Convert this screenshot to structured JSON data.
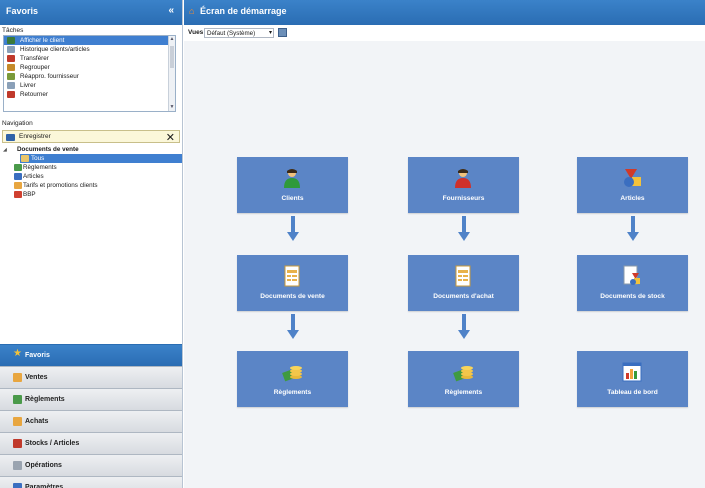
{
  "left": {
    "title": "Favoris",
    "collapse_glyph": "«",
    "taches_label": "Tâches",
    "taches": [
      {
        "label": "Afficher le client",
        "icon": "client-icon",
        "color": "#3a7a3a",
        "selected": true
      },
      {
        "label": "Historique clients/articles",
        "icon": "history-icon",
        "color": "#8aa0b8",
        "selected": false
      },
      {
        "label": "Transférer",
        "icon": "transfer-icon",
        "color": "#c0392b",
        "selected": false
      },
      {
        "label": "Regrouper",
        "icon": "group-icon",
        "color": "#c58a2a",
        "selected": false
      },
      {
        "label": "Réappro. fournisseur",
        "icon": "supplier-icon",
        "color": "#7a9a3a",
        "selected": false
      },
      {
        "label": "Livrer",
        "icon": "deliver-icon",
        "color": "#8aa0b8",
        "selected": false
      },
      {
        "label": "Retourner",
        "icon": "return-icon",
        "color": "#c0392b",
        "selected": false
      }
    ],
    "navigation_label": "Navigation",
    "enregistrer_label": "Enregistrer",
    "close_glyph": "✕",
    "tree": [
      {
        "label": "Documents de vente",
        "level": 0,
        "bold": true,
        "icon": "expand-icon",
        "color": "#555555",
        "selected": false
      },
      {
        "label": "Tous",
        "level": 2,
        "bold": false,
        "icon": "folder-icon",
        "color": "#e8c56a",
        "selected": true
      },
      {
        "label": "Règlements",
        "level": 1,
        "bold": false,
        "icon": "payment-icon",
        "color": "#4a9a4a",
        "selected": false
      },
      {
        "label": "Articles",
        "level": 1,
        "bold": false,
        "icon": "articles-icon",
        "color": "#3a6ec0",
        "selected": false
      },
      {
        "label": "Tarifs et promotions clients",
        "level": 1,
        "bold": false,
        "icon": "pricing-icon",
        "color": "#e8a640",
        "selected": false
      },
      {
        "label": "BBP",
        "level": 1,
        "bold": false,
        "icon": "bbp-icon",
        "color": "#d04030",
        "selected": false
      }
    ],
    "nav_buttons": [
      {
        "label": "Favoris",
        "icon": "star-icon",
        "color": "#f3c23a",
        "active": true
      },
      {
        "label": "Ventes",
        "icon": "sales-icon",
        "color": "#e8a640",
        "active": false
      },
      {
        "label": "Règlements",
        "icon": "payment-icon",
        "color": "#4a9a4a",
        "active": false
      },
      {
        "label": "Achats",
        "icon": "purchase-icon",
        "color": "#e8a640",
        "active": false
      },
      {
        "label": "Stocks / Articles",
        "icon": "stock-icon",
        "color": "#c0392b",
        "active": false
      },
      {
        "label": "Opérations",
        "icon": "operations-icon",
        "color": "#9aa4b0",
        "active": false
      },
      {
        "label": "Paramètres",
        "icon": "settings-icon",
        "color": "#3a6ec0",
        "active": false
      }
    ]
  },
  "main": {
    "title": "Écran de démarrage",
    "vues_label": "Vues",
    "vues_value": "Défaut (Système)",
    "tiles": [
      {
        "id": "clients",
        "label": "Clients",
        "icon": "client-icon"
      },
      {
        "id": "fournisseurs",
        "label": "Fournisseurs",
        "icon": "supplier-icon"
      },
      {
        "id": "articles",
        "label": "Articles",
        "icon": "articles-icon"
      },
      {
        "id": "docs-vente",
        "label": "Documents de vente",
        "icon": "sales-document-icon"
      },
      {
        "id": "docs-achat",
        "label": "Documents d'achat",
        "icon": "purchase-document-icon"
      },
      {
        "id": "docs-stock",
        "label": "Documents de stock",
        "icon": "stock-document-icon"
      },
      {
        "id": "reglements-1",
        "label": "Règlements",
        "icon": "payment-icon"
      },
      {
        "id": "reglements-2",
        "label": "Règlements",
        "icon": "payment-icon"
      },
      {
        "id": "tableau-bord",
        "label": "Tableau de bord",
        "icon": "dashboard-icon"
      }
    ]
  },
  "colors": {
    "header_blue": "#2a6db3",
    "tile_blue": "#5b85c6",
    "arrow_blue": "#4f82c8",
    "selection_blue": "#3f7fd0"
  }
}
